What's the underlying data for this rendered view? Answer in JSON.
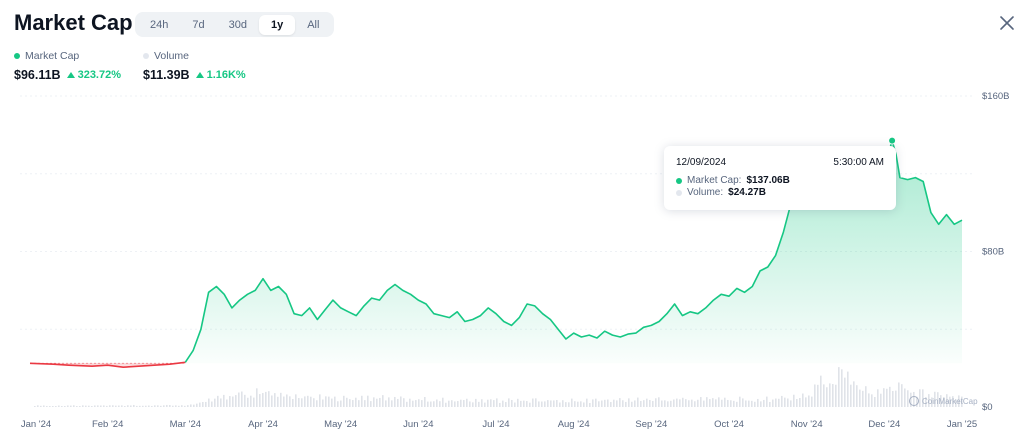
{
  "header": {
    "title": "Market Cap",
    "tabs": [
      {
        "label": "24h",
        "active": false
      },
      {
        "label": "7d",
        "active": false
      },
      {
        "label": "30d",
        "active": false
      },
      {
        "label": "1y",
        "active": true
      },
      {
        "label": "All",
        "active": false
      }
    ]
  },
  "legend": {
    "market_cap": {
      "label": "Market Cap",
      "value": "$96.11B",
      "change": "323.72%",
      "color": "#16c784"
    },
    "volume": {
      "label": "Volume",
      "value": "$11.39B",
      "change": "1.16K%",
      "color": "#e3e7ee"
    }
  },
  "tooltip": {
    "date": "12/09/2024",
    "time": "5:30:00 AM",
    "market_cap_label": "Market Cap:",
    "market_cap_value": "$137.06B",
    "volume_label": "Volume:",
    "volume_value": "$24.27B"
  },
  "watermark": "CoinMarketCap",
  "colors": {
    "up": "#16c784",
    "down": "#ea3943",
    "volume": "#d5d9e0",
    "grid": "#eef1f5"
  },
  "chart_data": {
    "type": "area",
    "x_ticks": [
      "Jan '24",
      "Feb '24",
      "Mar '24",
      "Apr '24",
      "May '24",
      "Jun '24",
      "Jul '24",
      "Aug '24",
      "Sep '24",
      "Oct '24",
      "Nov '24",
      "Dec '24",
      "Jan '25"
    ],
    "y_ticks": [
      "$0",
      "$80B",
      "$160B"
    ],
    "ylim": [
      0,
      160
    ],
    "grid": true,
    "series": [
      {
        "name": "Market Cap",
        "unit": "B USD",
        "x": [
          0,
          0.3,
          0.5,
          0.8,
          1.0,
          1.2,
          1.4,
          1.6,
          1.8,
          2.0,
          2.1,
          2.2,
          2.3,
          2.4,
          2.5,
          2.6,
          2.7,
          2.8,
          2.9,
          3.0,
          3.1,
          3.2,
          3.3,
          3.4,
          3.5,
          3.6,
          3.7,
          3.8,
          3.9,
          4.0,
          4.1,
          4.2,
          4.3,
          4.4,
          4.5,
          4.6,
          4.7,
          4.8,
          4.9,
          5.0,
          5.1,
          5.2,
          5.3,
          5.4,
          5.5,
          5.6,
          5.7,
          5.8,
          5.9,
          6.0,
          6.1,
          6.2,
          6.3,
          6.4,
          6.5,
          6.6,
          6.7,
          6.8,
          6.9,
          7.0,
          7.1,
          7.2,
          7.3,
          7.4,
          7.5,
          7.6,
          7.7,
          7.8,
          7.9,
          8.0,
          8.1,
          8.2,
          8.3,
          8.4,
          8.5,
          8.6,
          8.7,
          8.8,
          8.9,
          9.0,
          9.1,
          9.2,
          9.3,
          9.4,
          9.5,
          9.6,
          9.7,
          9.8,
          9.9,
          10.0,
          10.05,
          10.1,
          10.15,
          10.2,
          10.3,
          10.4,
          10.5,
          10.6,
          10.7,
          10.8,
          10.9,
          11.0,
          11.05,
          11.1,
          11.15,
          11.2,
          11.3,
          11.4,
          11.5,
          11.6,
          11.7,
          11.8,
          11.9,
          12.0
        ],
        "y": [
          22.5,
          22.0,
          21.5,
          21.0,
          21.5,
          20.5,
          21.0,
          21.5,
          22.0,
          23.0,
          29.0,
          40.0,
          59.0,
          62.0,
          58.0,
          51.0,
          55.0,
          58.0,
          60.0,
          66.0,
          60.0,
          62.0,
          58.0,
          48.0,
          47.0,
          51.0,
          45.0,
          50.0,
          55.0,
          51.0,
          49.0,
          47.0,
          52.0,
          56.0,
          55.0,
          60.0,
          63.0,
          60.0,
          58.0,
          55.0,
          53.0,
          48.0,
          47.0,
          46.0,
          49.0,
          44.0,
          45.0,
          47.0,
          51.0,
          48.0,
          44.0,
          42.0,
          46.0,
          53.0,
          52.0,
          48.0,
          45.0,
          40.0,
          35.0,
          38.0,
          36.0,
          37.0,
          35.5,
          39.0,
          37.0,
          36.0,
          37.5,
          38.0,
          41.0,
          42.0,
          44.0,
          48.0,
          53.0,
          47.0,
          49.0,
          48.0,
          51.0,
          55.0,
          58.0,
          57.0,
          61.0,
          59.0,
          62.0,
          70.0,
          72.0,
          78.0,
          90.0,
          105.0,
          120.0,
          124.0,
          126.0,
          128.0,
          127.0,
          126.0,
          125.0,
          124.0,
          123.0,
          122.0,
          121.0,
          122.0,
          124.0,
          125.0,
          130.0,
          137.06,
          130.0,
          118.0,
          117.0,
          118.0,
          116.0,
          100.0,
          94.0,
          99.0,
          94.0,
          96.11
        ],
        "color": "#16c784"
      },
      {
        "name": "Volume",
        "unit": "B USD",
        "x": [
          0,
          1,
          2,
          2.3,
          2.6,
          3,
          3.5,
          4,
          4.5,
          5,
          5.5,
          6,
          6.5,
          7,
          7.5,
          8,
          8.5,
          9,
          9.5,
          10,
          10.2,
          10.4,
          10.6,
          10.8,
          11,
          11.2,
          11.4,
          11.6,
          11.8,
          12
        ],
        "y": [
          1,
          1,
          1.5,
          5,
          10,
          12,
          8,
          7,
          7,
          6,
          5,
          5,
          5,
          5,
          5,
          6,
          6,
          6,
          6,
          8,
          20,
          25,
          18,
          10,
          14,
          15,
          12,
          10,
          8,
          7
        ],
        "color": "#d5d9e0"
      }
    ]
  }
}
